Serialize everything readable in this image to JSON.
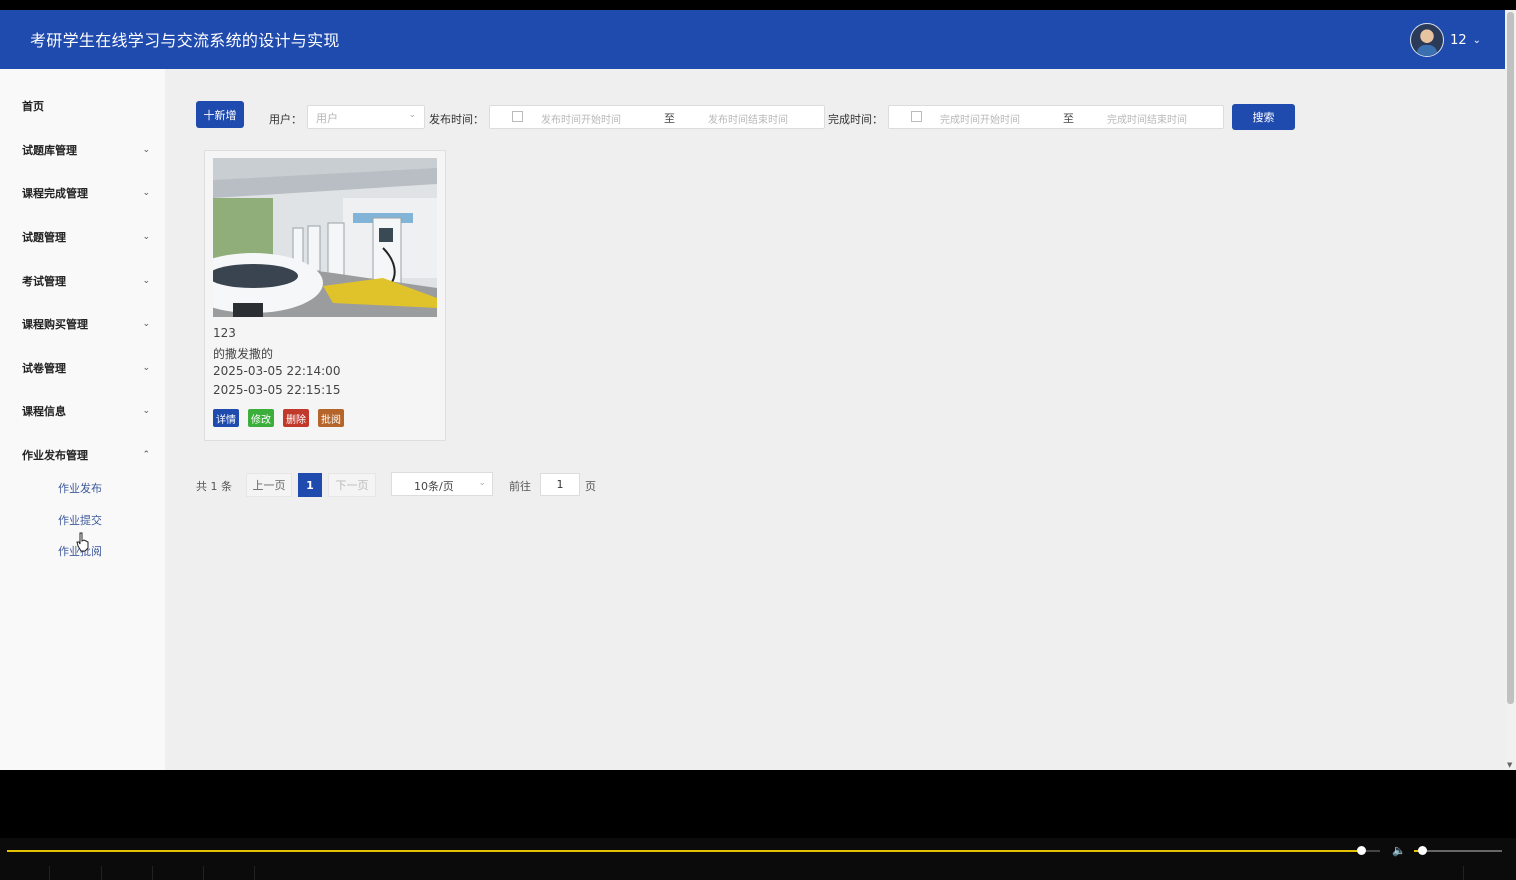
{
  "header": {
    "title": "考研学生在线学习与交流系统的设计与实现",
    "user_name": "12",
    "colors": {
      "primary": "#1f4aae"
    }
  },
  "sidebar": {
    "home": "首页",
    "groups": [
      {
        "label": "试题库管理"
      },
      {
        "label": "课程完成管理"
      },
      {
        "label": "试题管理"
      },
      {
        "label": "考试管理"
      },
      {
        "label": "课程购买管理"
      },
      {
        "label": "试卷管理"
      },
      {
        "label": "课程信息"
      },
      {
        "label": "作业发布管理",
        "expanded": true,
        "children": [
          "作业发布",
          "作业提交",
          "作业批阅"
        ]
      }
    ]
  },
  "toolbar": {
    "add_label": "十新增",
    "user_label": "用户：",
    "user_placeholder": "用户",
    "publish_label": "发布时间：",
    "publish_start_placeholder": "发布时间开始时间",
    "publish_end_placeholder": "发布时间结束时间",
    "to_label": "至",
    "finish_label": "完成时间：",
    "finish_start_placeholder": "完成时间开始时间",
    "finish_end_placeholder": "完成时间结束时间",
    "search_label": "搜索"
  },
  "cards": [
    {
      "image_icon": "ev-charging-station-photo",
      "name": "123",
      "content": "的撒发撒的",
      "publish_time": "2025-03-05 22:14:00",
      "finish_time": "2025-03-05 22:15:15",
      "actions": [
        {
          "label": "详情",
          "color": "#1f4aae"
        },
        {
          "label": "修改",
          "color": "#3cae3c"
        },
        {
          "label": "删除",
          "color": "#c0392b"
        },
        {
          "label": "批阅",
          "color": "#b5652a"
        }
      ]
    }
  ],
  "pagination": {
    "total_text": "共 1 条",
    "prev": "上一页",
    "current": "1",
    "next": "下一页",
    "page_size": "10条/页",
    "goto_label": "前往",
    "goto_value": "1",
    "page_unit": "页"
  },
  "player": {
    "progress_fraction": 0.895,
    "volume_fraction": 0.1
  }
}
